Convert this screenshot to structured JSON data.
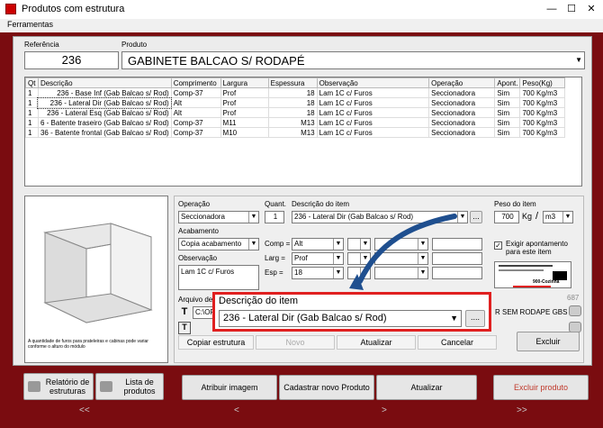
{
  "window": {
    "title": "Produtos com estrutura",
    "min": "—",
    "max": "☐",
    "close": "✕"
  },
  "menu": {
    "ferramentas": "Ferramentas"
  },
  "header": {
    "referencia_label": "Referência",
    "referencia_value": "236",
    "produto_label": "Produto",
    "produto_value": "GABINETE BALCAO S/ RODAPÉ"
  },
  "grid": {
    "columns": [
      "Qt",
      "Descrição",
      "Comprimento",
      "Largura",
      "Espessura",
      "Observação",
      "Operação",
      "Apont.",
      "Peso(Kg)"
    ],
    "rows": [
      [
        "1",
        "236 - Base Inf (Gab Balcao s/ Rod)",
        "Comp-37",
        "Prof",
        "18",
        "Lam 1C c/ Furos",
        "Seccionadora",
        "Sim",
        "700 Kg/m3"
      ],
      [
        "1",
        "236 - Lateral Dir (Gab Balcao s/ Rod)",
        "Alt",
        "Prof",
        "18",
        "Lam 1C c/ Furos",
        "Seccionadora",
        "Sim",
        "700 Kg/m3"
      ],
      [
        "1",
        "236 - Lateral Esq (Gab Balcao s/ Rod)",
        "Alt",
        "Prof",
        "18",
        "Lam 1C c/ Furos",
        "Seccionadora",
        "Sim",
        "700 Kg/m3"
      ],
      [
        "1",
        "6 - Batente traseiro (Gab Balcao s/ Rod)",
        "Comp-37",
        "M11",
        "M13",
        "Lam 1C c/ Furos",
        "Seccionadora",
        "Sim",
        "700 Kg/m3"
      ],
      [
        "1",
        "36 - Batente frontal (Gab Balcao s/ Rod)",
        "Comp-37",
        "M10",
        "M13",
        "Lam 1C c/ Furos",
        "Seccionadora",
        "Sim",
        "700 Kg/m3"
      ]
    ]
  },
  "preview": {
    "caption": "A quantidade de furos para prateleiras e cabinas pode variar conforme o alturo do módulo"
  },
  "form": {
    "operacao_label": "Operação",
    "operacao_value": "Seccionadora",
    "quant_label": "Quant.",
    "quant_value": "1",
    "descricao_label": "Descrição do item",
    "descricao_value": "236 - Lateral Dir (Gab Balcao s/ Rod)",
    "peso_label": "Peso do item",
    "peso_value": "700",
    "peso_unit": "Kg",
    "peso_per": "m3",
    "acabamento_label": "Acabamento",
    "acabamento_value": "Copia acabamento",
    "comp_label": "Comp =",
    "comp_value": "Alt",
    "larg_label": "Larg =",
    "larg_value": "Prof",
    "esp_label": "Esp =",
    "esp_value": "18",
    "observacao_label": "Observação",
    "observacao_value": "Lam 1C c/ Furos",
    "exigir_label": "Exigir apontamento para este item",
    "arquivo_label": "Arquivo de furação (CNC)",
    "arquivo_value": "C:\\OPP",
    "arquivo_right": "R SEM RODAPE GBS",
    "small_number": "687",
    "label_text": "900-Cozinha"
  },
  "actions": {
    "copiar": "Copiar estrutura",
    "novo": "Novo",
    "atualizar": "Atualizar",
    "cancelar": "Cancelar",
    "excluir": "Excluir"
  },
  "zoom": {
    "label": "Descrição do item",
    "value": "236 - Lateral Dir (Gab Balcao s/ Rod)",
    "more": "...."
  },
  "bottom": {
    "relatorio": "Relatório de estruturas",
    "lista": "Lista de produtos",
    "atribuir": "Atribuir imagem",
    "cadastrar": "Cadastrar novo Produto",
    "atualizar": "Atualizar",
    "excluir_produto": "Excluir produto"
  },
  "nav": {
    "first": "<<",
    "prev": "<",
    "next": ">",
    "last": ">>"
  },
  "colors": {
    "frame": "#7a0c10",
    "highlight": "#e02020",
    "excluir_text": "#c0392b",
    "arrow": "#1f4f8f"
  }
}
